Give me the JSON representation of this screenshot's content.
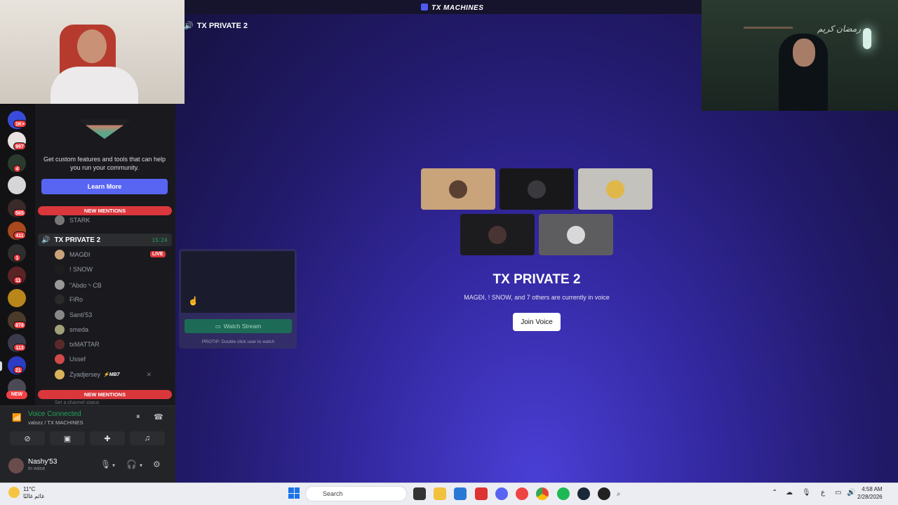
{
  "window": {
    "title": "TX MACHINES"
  },
  "channel": {
    "name": "TX PRIVATE 2",
    "header_icon": "speaker-icon"
  },
  "voice_stage": {
    "title": "TX PRIVATE 2",
    "subtitle": "MAGÐI, ! SNOW, and 7 others are currently in voice",
    "join_label": "Join Voice"
  },
  "webcam_right": {
    "overlay_text": "رمضان كريم"
  },
  "server_rail": {
    "badges": [
      "1K+",
      "997",
      "4",
      "565",
      "411",
      "1",
      "11",
      "878",
      "113",
      "21"
    ],
    "new_label": "NEW"
  },
  "promo": {
    "text": "Get custom features and tools that can help you run your community.",
    "button": "Learn More"
  },
  "mentions_label": "NEW MENTIONS",
  "sidebar_users_above": [
    "STARK"
  ],
  "voice_channel": {
    "name": "TX PRIVATE 2",
    "timer": "15:24",
    "live_label": "LIVE",
    "users": [
      "MAGÐI",
      "! SNOW",
      "\"Abdo丶CB",
      "FiRo",
      "Santi'53",
      "smeda",
      "txMATTAR",
      "Ussef",
      "Zyadjersey"
    ],
    "tag": "⚡MB7"
  },
  "stream_preview": {
    "watch_label": "Watch Stream",
    "protip": "PROTIP: Double click user to watch"
  },
  "set_status": "Set a channel status",
  "voice_panel": {
    "status": "Voice Connected",
    "where": "valozz / TX MACHINES",
    "user_name": "Nashy'53",
    "user_status": "In voice"
  },
  "taskbar": {
    "weather_temp": "11°C",
    "weather_desc": "غائم غالبًا",
    "search_placeholder": "Search",
    "lang": "ع",
    "time": "4:58 AM",
    "date": "2/28/2026"
  }
}
